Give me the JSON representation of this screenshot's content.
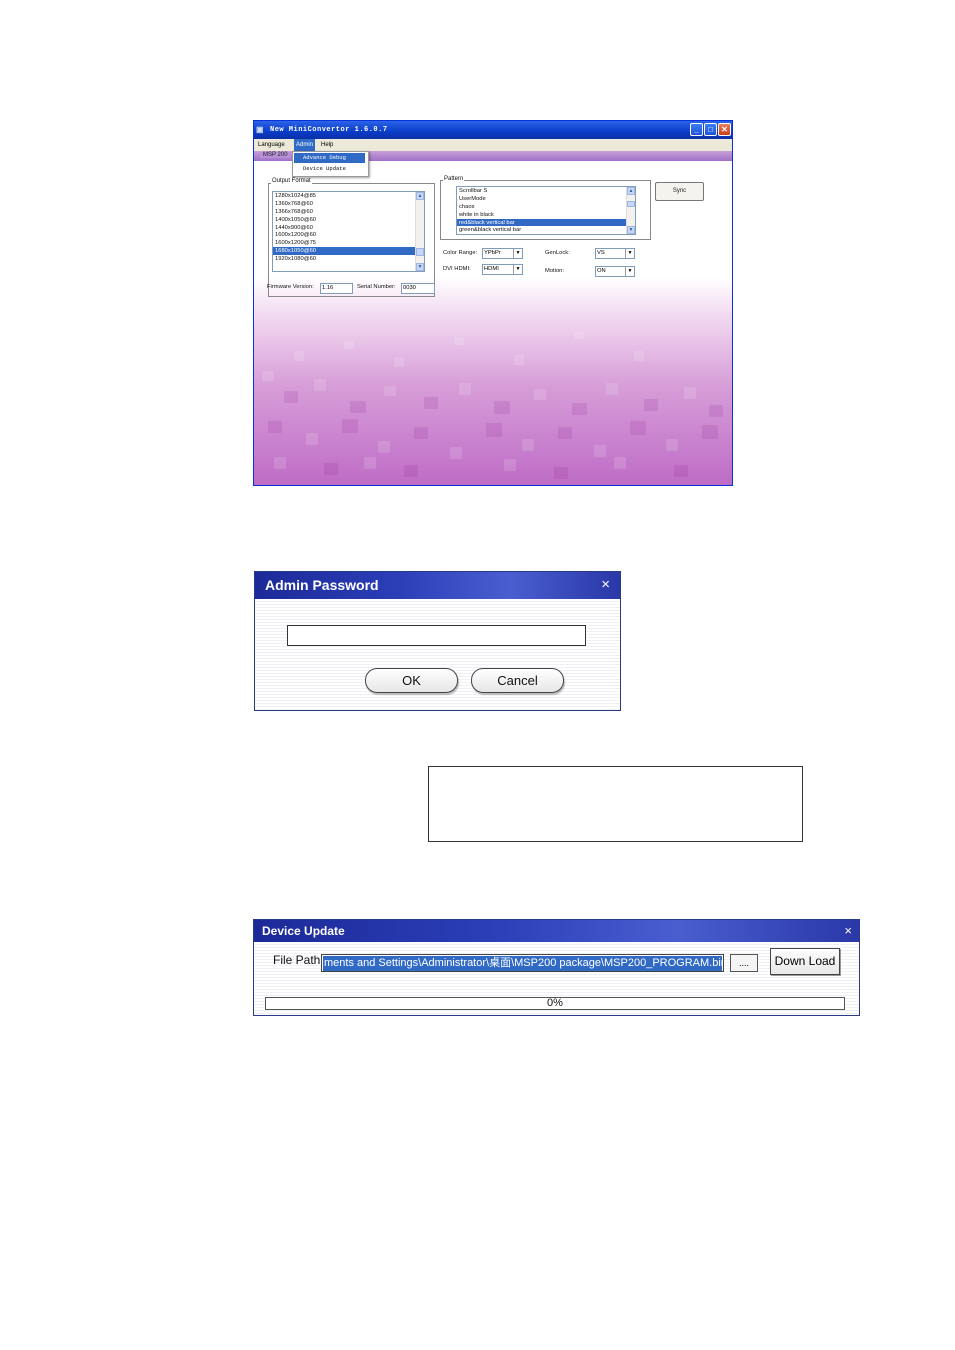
{
  "main_window": {
    "title": "New MiniConvertor 1.6.0.7",
    "menus": [
      "Language",
      "Admin",
      "Help"
    ],
    "admin_menu_items": [
      "Advance Debug",
      "Device Update"
    ],
    "tab_label": "MSP 200",
    "output_format": {
      "label": "Output Format",
      "items": [
        "1280x1024@85",
        "1360x768@60",
        "1366x768@60",
        "1400x1050@60",
        "1440x900@60",
        "1600x1200@60",
        "1600x1200@75",
        "1680x1050@60",
        "1920x1080@60"
      ],
      "selected": "1680x1050@60"
    },
    "pattern": {
      "label": "Pattern",
      "items": [
        "Scrollbar S",
        "UserMode",
        "chaos",
        "white in black",
        "red&black vertical bar",
        "green&black vertical bar"
      ],
      "selected": "red&black vertical bar"
    },
    "sync_button": "Sync",
    "color_range": {
      "label": "Color Range:",
      "value": "YPbPr"
    },
    "dvi_hdmi": {
      "label": "DVI HDMI:",
      "value": "HDMI"
    },
    "genlock": {
      "label": "GenLock:",
      "value": "VS"
    },
    "motion": {
      "label": "Motion:",
      "value": "ON"
    },
    "firmware": {
      "label": "Firmware Version:",
      "value": "1.16"
    },
    "serial": {
      "label": "Serial Number:",
      "value": "0030"
    }
  },
  "admin_password": {
    "title": "Admin Password",
    "close_glyph": "×",
    "ok_label": "OK",
    "cancel_label": "Cancel"
  },
  "device_update": {
    "title": "Device Update",
    "close_glyph": "×",
    "file_path_label": "File Path",
    "file_path_value": "ments and Settings\\Administrator\\桌面\\MSP200 package\\MSP200_PROGRAM.bin",
    "browse_label": "....",
    "download_label": "Down Load",
    "progress_text": "0%",
    "progress_percent": 0
  },
  "colors": {
    "selection": "#316ac5",
    "title_blue": "#2c3fb8",
    "client_purple": "#be6cc6"
  }
}
